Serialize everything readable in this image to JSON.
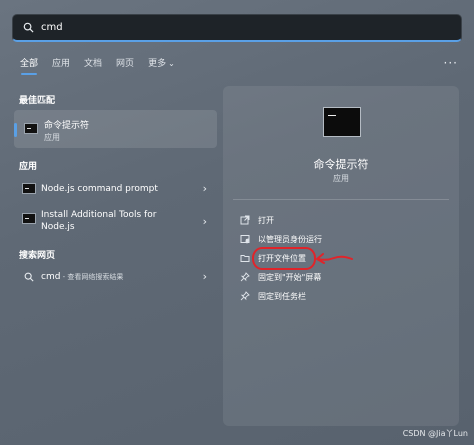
{
  "search": {
    "value": "cmd"
  },
  "tabs": [
    {
      "label": "全部"
    },
    {
      "label": "应用"
    },
    {
      "label": "文档"
    },
    {
      "label": "网页"
    },
    {
      "label": "更多"
    }
  ],
  "sections": {
    "best_match": "最佳匹配",
    "apps": "应用",
    "web": "搜索网页"
  },
  "best_match": {
    "title": "命令提示符",
    "subtitle": "应用"
  },
  "apps": [
    {
      "label": "Node.js command prompt"
    },
    {
      "label_line1": "Install Additional Tools for",
      "label_line2": "Node.js"
    }
  ],
  "web_result": {
    "query": "cmd",
    "hint": " - 查看网络搜索结果"
  },
  "preview": {
    "title": "命令提示符",
    "subtitle": "应用",
    "actions": [
      {
        "label": "打开",
        "icon": "open-icon"
      },
      {
        "label": "以管理员身份运行",
        "icon": "admin-shield-icon"
      },
      {
        "label": "打开文件位置",
        "icon": "folder-icon"
      },
      {
        "label": "固定到\"开始\"屏幕",
        "icon": "pin-icon"
      },
      {
        "label": "固定到任务栏",
        "icon": "pin-icon"
      }
    ]
  },
  "annotation_color": "#e0242a",
  "accent_color": "#5aa0e6",
  "watermark": "CSDN @Jia丫Lun"
}
